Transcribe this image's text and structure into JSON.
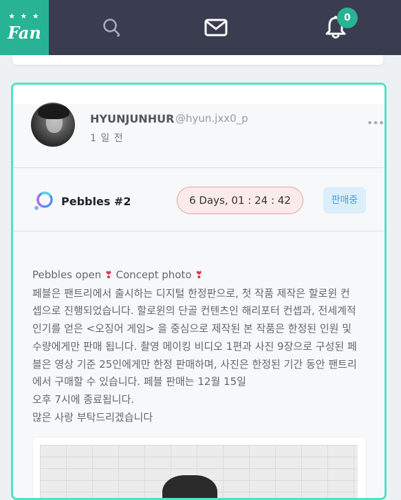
{
  "nav": {
    "logo_text": "Fan",
    "logo_stars": "★ ★ ★",
    "notification_count": "0",
    "brand_color": "#27b394",
    "nav_bg": "#3a3d4f"
  },
  "post": {
    "user_name": "HYUNJUNHUR",
    "user_handle": "@hyun.jxx0_p",
    "time_ago": "1 일 전",
    "more_label": "•••",
    "product_name": "Pebbles  #2",
    "countdown": "6 Days, 01 : 24 : 42",
    "sale_status": "판매중",
    "accent_border": "#4fe3c3",
    "body": {
      "title_a": "Pebbles open ",
      "title_b": " Concept photo ",
      "heart": "❣",
      "lines": [
        "페블은 팬트리에서 출시하는 디지털 한정판으로, 첫 작품 제작은 할로윈 컨",
        "셉으로 진행되었습니다. 할로윈의 단골 컨텐츠인 해리포터 컨셉과, 전세계적",
        "인기를 얻은 <오징어 게임> 을 중심으로 제작된 본 작품은 한정된 인원 및",
        "수량에게만 판매 됩니다. 촬영 메이킹 비디오 1편과 사진 9장으로 구성된 페",
        "블은 영상 기준 25인에게만 한정 판매하며, 사진은 한정된 기간 동안 팬트리",
        "에서 구매할 수 있습니다. 페블 판매는 12월 15일",
        "오후 7시에 종료됩니다.",
        "많은 사랑 부탁드리겠습니다"
      ]
    }
  }
}
